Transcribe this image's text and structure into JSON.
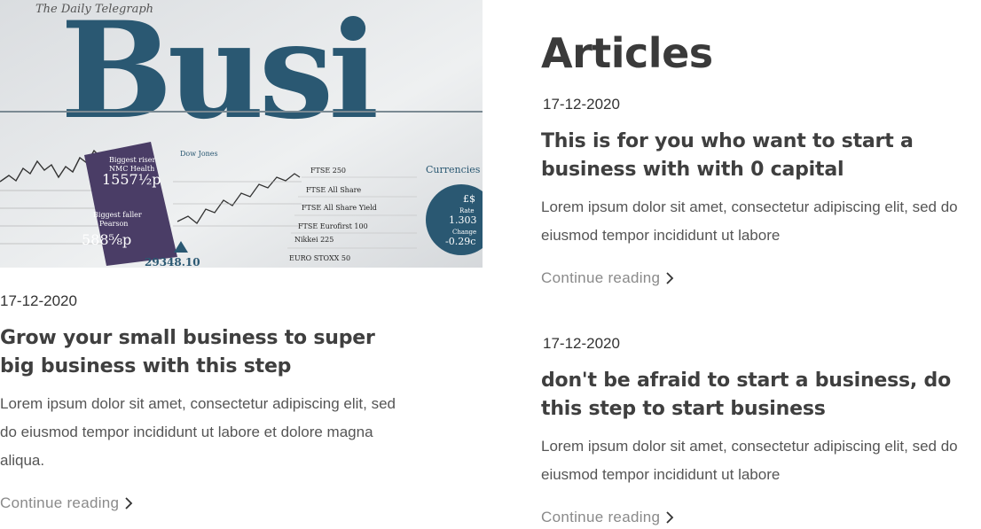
{
  "section": {
    "title": "Articles"
  },
  "featured": {
    "image_alt": "Newspaper business section",
    "date": "17-12-2020",
    "title": "Grow your small business to super big business with this step",
    "excerpt": "Lorem ipsum dolor sit amet, consectetur adipiscing elit, sed do eiusmod tempor incididunt ut labore et dolore magna aliqua.",
    "continue_label": "Continue reading"
  },
  "articles": [
    {
      "date": "17-12-2020",
      "title": "This is for you who want to start a business with with 0 capital",
      "excerpt": "Lorem ipsum dolor sit amet, consectetur adipiscing elit, sed do eiusmod tempor incididunt ut labore",
      "continue_label": "Continue reading"
    },
    {
      "date": "17-12-2020",
      "title": "don't be afraid to start a business, do this step to start business",
      "excerpt": "Lorem ipsum dolor sit amet, consectetur adipiscing elit, sed do eiusmod tempor incididunt ut labore",
      "continue_label": "Continue reading"
    }
  ],
  "icons": {
    "continue": "chevron-right-icon"
  },
  "colors": {
    "heading": "#3f3f3f",
    "body": "#555555",
    "link": "#8a8a8a",
    "newsprint_ink": "#2a5872"
  },
  "newspaper_text": {
    "masthead": "The Daily Telegraph",
    "headline": "Busi",
    "sidebar_1": "Biggest riser",
    "sidebar_1b": "NMC Health",
    "price_1": "1557½p",
    "sidebar_2": "Biggest faller",
    "sidebar_2b": "Pearson",
    "price_2": "588⅝p",
    "dow": "Dow Jones",
    "ftse": "FTSE 250",
    "ftse_all": "FTSE All Share",
    "ftse_yield": "FTSE All Share Yield",
    "eurofirst": "FTSE Eurofirst 100",
    "nikkei": "Nikkei 225",
    "euro": "EURO STOXX 50",
    "currencies": "Currencies",
    "pound": "£$",
    "rate": "Rate",
    "rate_val": "1.303",
    "change": "Change",
    "change_val": "-0.29c",
    "index_val": "29348.10"
  }
}
